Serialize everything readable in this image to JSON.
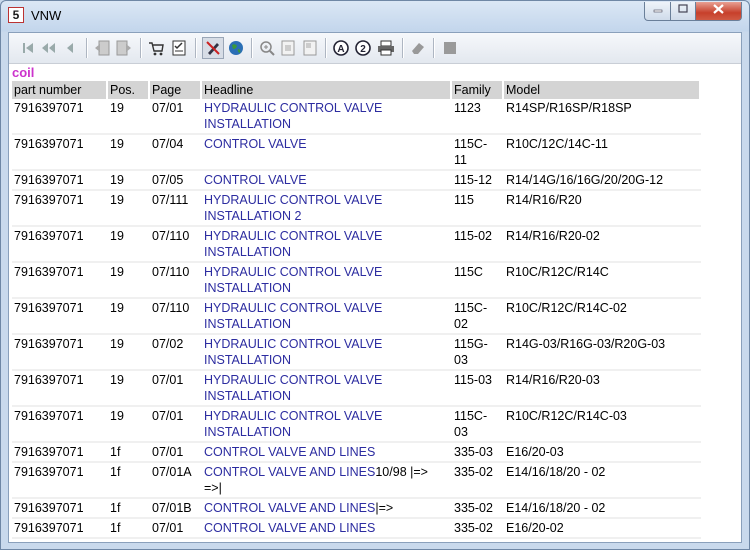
{
  "window": {
    "title": "VNW",
    "app_icon": "app-logo-icon"
  },
  "toolbar": [
    {
      "name": "first-record-icon"
    },
    {
      "name": "previous-page-icon"
    },
    {
      "name": "previous-record-icon"
    },
    {
      "name": "export-left-icon"
    },
    {
      "name": "export-right-icon"
    },
    {
      "name": "cart-icon"
    },
    {
      "name": "checklist-icon"
    },
    {
      "name": "highlight-pen-icon"
    },
    {
      "name": "globe-icon"
    },
    {
      "name": "zoom-icon"
    },
    {
      "name": "page-icon"
    },
    {
      "name": "page-alt-icon"
    },
    {
      "name": "annotation-a-icon"
    },
    {
      "name": "annotation-2-icon"
    },
    {
      "name": "print-icon"
    },
    {
      "name": "eraser-icon"
    },
    {
      "name": "stop-icon"
    }
  ],
  "search_term": "coil",
  "table": {
    "headers": [
      "part number",
      "Pos.",
      "Page",
      "Headline",
      "Family",
      "Model"
    ],
    "rows": [
      {
        "part": "7916397071",
        "pos": "19",
        "page": "07/01",
        "headline": "HYDRAULIC CONTROL VALVE INSTALLATION",
        "family": "1123",
        "model": "R14SP/R16SP/R18SP"
      },
      {
        "part": "7916397071",
        "pos": "19",
        "page": "07/04",
        "headline": "CONTROL VALVE",
        "family": "115C-11",
        "model": "R10C/12C/14C-11"
      },
      {
        "part": "7916397071",
        "pos": "19",
        "page": "07/05",
        "headline": "CONTROL VALVE",
        "family": "115-12",
        "model": "R14/14G/16/16G/20/20G-12"
      },
      {
        "part": "7916397071",
        "pos": "19",
        "page": "07/111",
        "headline": "HYDRAULIC CONTROL VALVE INSTALLATION 2",
        "family": "115",
        "model": "R14/R16/R20"
      },
      {
        "part": "7916397071",
        "pos": "19",
        "page": "07/110",
        "headline": "HYDRAULIC CONTROL VALVE INSTALLATION",
        "family": "115-02",
        "model": "R14/R16/R20-02"
      },
      {
        "part": "7916397071",
        "pos": "19",
        "page": "07/110",
        "headline": "HYDRAULIC CONTROL VALVE INSTALLATION",
        "family": "115C",
        "model": "R10C/R12C/R14C"
      },
      {
        "part": "7916397071",
        "pos": "19",
        "page": "07/110",
        "headline": "HYDRAULIC CONTROL VALVE INSTALLATION",
        "family": "115C-02",
        "model": "R10C/R12C/R14C-02"
      },
      {
        "part": "7916397071",
        "pos": "19",
        "page": "07/02",
        "headline": "HYDRAULIC CONTROL VALVE INSTALLATION",
        "family": "115G-03",
        "model": "R14G-03/R16G-03/R20G-03"
      },
      {
        "part": "7916397071",
        "pos": "19",
        "page": "07/01",
        "headline": "HYDRAULIC CONTROL VALVE INSTALLATION",
        "family": "115-03",
        "model": "R14/R16/R20-03"
      },
      {
        "part": "7916397071",
        "pos": "19",
        "page": "07/01",
        "headline": "HYDRAULIC CONTROL VALVE INSTALLATION",
        "family": "115C-03",
        "model": "R10C/R12C/R14C-03"
      },
      {
        "part": "7916397071",
        "pos": "1f",
        "page": "07/01",
        "headline": "CONTROL VALVE AND LINES",
        "family": "335-03",
        "model": "E16/20-03"
      },
      {
        "part": "7916397071",
        "pos": "1f",
        "page": "07/01A",
        "headline": "CONTROL VALVE AND LINES",
        "headline_suffix": "10/98 |=> =>|",
        "family": "335-02",
        "model": "E14/16/18/20 - 02"
      },
      {
        "part": "7916397071",
        "pos": "1f",
        "page": "07/01B",
        "headline": "CONTROL VALVE AND LINES",
        "headline_suffix": "|=>",
        "family": "335-02",
        "model": "E14/16/18/20 - 02"
      },
      {
        "part": "7916397071",
        "pos": "1f",
        "page": "07/01",
        "headline": "CONTROL VALVE AND LINES",
        "family": "335-02",
        "model": "E16/20-02"
      }
    ]
  }
}
